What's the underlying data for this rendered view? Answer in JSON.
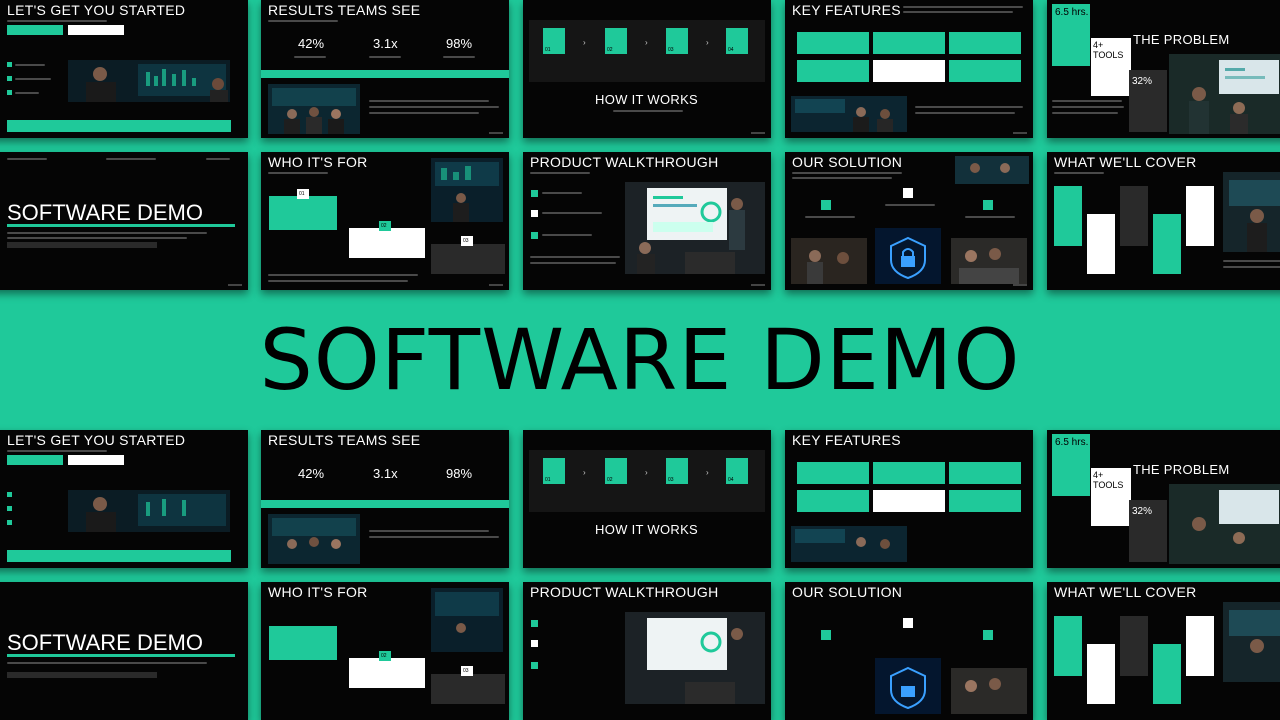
{
  "hero_title": "SOFTWARE DEMO",
  "slides": {
    "get_started": {
      "title": "LET'S GET YOU STARTED"
    },
    "results": {
      "title": "RESULTS TEAMS SEE",
      "stats": [
        "42%",
        "3.1x",
        "98%"
      ]
    },
    "how_it_works": {
      "title": "HOW IT WORKS",
      "steps": [
        "01",
        "02",
        "03",
        "04"
      ]
    },
    "key_features": {
      "title": "KEY FEATURES"
    },
    "problem": {
      "title": "THE PROBLEM",
      "stat_a": "6.5 hrs.",
      "stat_b": "4+ TOOLS",
      "stat_c": "32%"
    },
    "cover": {
      "title": "SOFTWARE DEMO"
    },
    "who": {
      "title": "WHO IT'S FOR",
      "nums": [
        "01",
        "02",
        "03"
      ]
    },
    "walkthrough": {
      "title": "PRODUCT WALKTHROUGH"
    },
    "solution": {
      "title": "OUR SOLUTION"
    },
    "cover_list": {
      "title": "WHAT WE'LL COVER"
    }
  },
  "colors": {
    "accent": "#1fc99a",
    "slide_bg": "#050505"
  }
}
